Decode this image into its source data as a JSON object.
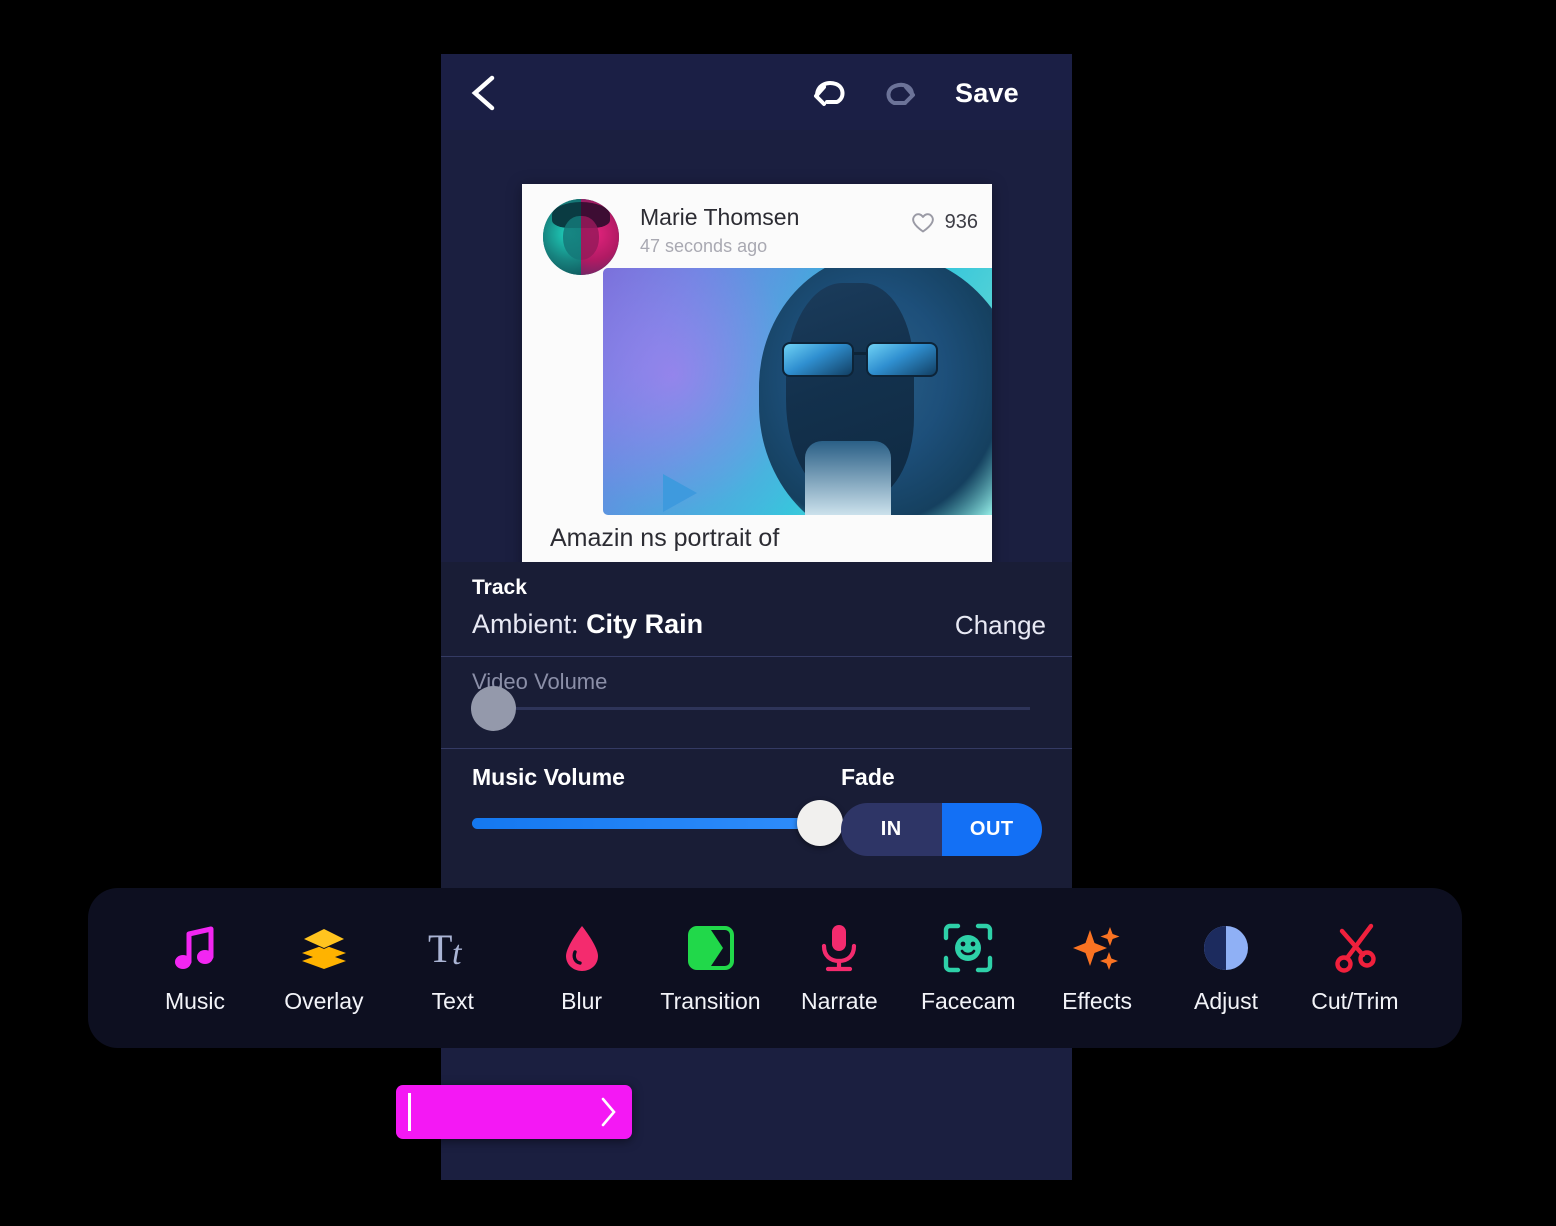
{
  "app": {
    "title": "Video Editor"
  },
  "topbar": {
    "back_icon": "chevron-left-icon",
    "undo_icon": "undo-icon",
    "redo_icon": "redo-icon",
    "save_label": "Save"
  },
  "preview": {
    "author_name": "Marie Thomsen",
    "timestamp": "47 seconds ago",
    "like_icon": "heart-icon",
    "like_count": "936",
    "caption": "Amazin               ns portrait of",
    "play_icon": "play-icon"
  },
  "track": {
    "section_label": "Track",
    "name_prefix": "Ambient: ",
    "name": "City Rain",
    "change_label": "Change"
  },
  "video_volume": {
    "label": "Video Volume",
    "value_percent": 0
  },
  "music_volume": {
    "label": "Music Volume",
    "value_percent": 100
  },
  "fade": {
    "label": "Fade",
    "options": [
      {
        "label": "IN",
        "selected": false
      },
      {
        "label": "OUT",
        "selected": true
      }
    ]
  },
  "toolbar": {
    "items": [
      {
        "label": "Music",
        "icon": "music-note-icon",
        "color": "#f226f2"
      },
      {
        "label": "Overlay",
        "icon": "layers-icon",
        "color": "#ffb300"
      },
      {
        "label": "Text",
        "icon": "text-tt-icon",
        "color": "#aab4d4"
      },
      {
        "label": "Blur",
        "icon": "droplet-icon",
        "color": "#f42b6e"
      },
      {
        "label": "Transition",
        "icon": "transition-icon",
        "color": "#21d84a"
      },
      {
        "label": "Narrate",
        "icon": "microphone-icon",
        "color": "#f42b6e"
      },
      {
        "label": "Facecam",
        "icon": "face-frame-icon",
        "color": "#2ed0a8"
      },
      {
        "label": "Effects",
        "icon": "sparkles-icon",
        "color": "#fa7322"
      },
      {
        "label": "Adjust",
        "icon": "contrast-icon",
        "color": "#8fb0f5"
      },
      {
        "label": "Cut/Trim",
        "icon": "scissors-icon",
        "color": "#f0203c"
      }
    ]
  },
  "action_pill": {
    "caret_icon": "text-caret-icon",
    "chevron_icon": "chevron-right-icon",
    "label": "",
    "color": "#f418f4"
  },
  "colors": {
    "phone_bg": "#1b1f40",
    "topbar_bg": "#1b1f45",
    "panel_bg": "#191d36",
    "toolbar_bg": "#0d0f20",
    "accent_blue": "#1370f5",
    "accent_magenta": "#f418f4",
    "divider": "#343a63"
  }
}
